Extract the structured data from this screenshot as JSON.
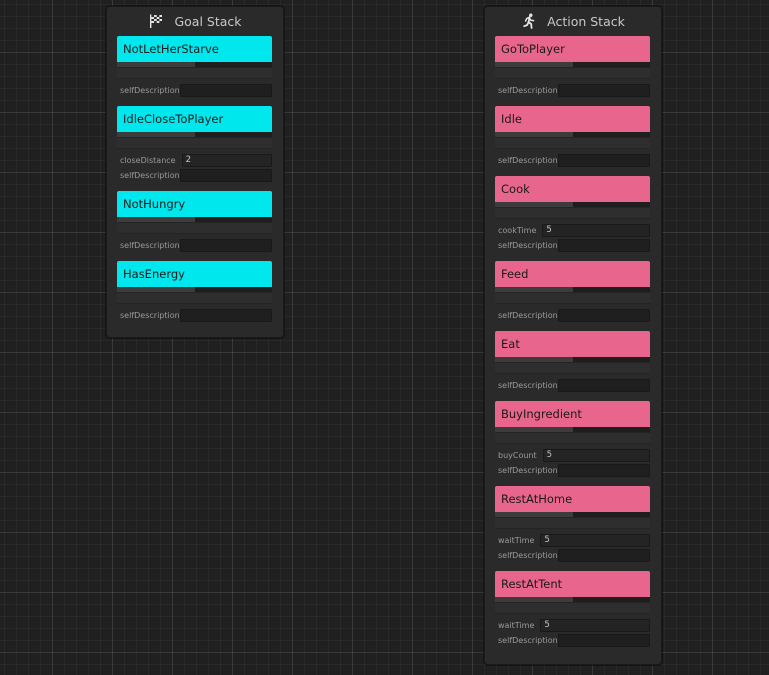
{
  "goal_stack": {
    "title": "Goal Stack",
    "icon": "checkered-flag-icon",
    "accent_color": "#00e8ed",
    "nodes": [
      {
        "name": "NotLetHerStarve",
        "fields": [
          {
            "label": "selfDescription",
            "value": ""
          }
        ]
      },
      {
        "name": "IdleCloseToPlayer",
        "fields": [
          {
            "label": "closeDistance",
            "value": "2"
          },
          {
            "label": "selfDescription",
            "value": ""
          }
        ]
      },
      {
        "name": "NotHungry",
        "fields": [
          {
            "label": "selfDescription",
            "value": ""
          }
        ]
      },
      {
        "name": "HasEnergy",
        "fields": [
          {
            "label": "selfDescription",
            "value": ""
          }
        ]
      }
    ]
  },
  "action_stack": {
    "title": "Action Stack",
    "icon": "running-person-icon",
    "accent_color": "#e8668d",
    "nodes": [
      {
        "name": "GoToPlayer",
        "fields": [
          {
            "label": "selfDescription",
            "value": ""
          }
        ]
      },
      {
        "name": "Idle",
        "fields": [
          {
            "label": "selfDescription",
            "value": ""
          }
        ]
      },
      {
        "name": "Cook",
        "fields": [
          {
            "label": "cookTime",
            "value": "5"
          },
          {
            "label": "selfDescription",
            "value": ""
          }
        ]
      },
      {
        "name": "Feed",
        "fields": [
          {
            "label": "selfDescription",
            "value": ""
          }
        ]
      },
      {
        "name": "Eat",
        "fields": [
          {
            "label": "selfDescription",
            "value": ""
          }
        ]
      },
      {
        "name": "BuyIngredient",
        "fields": [
          {
            "label": "buyCount",
            "value": "5"
          },
          {
            "label": "selfDescription",
            "value": ""
          }
        ]
      },
      {
        "name": "RestAtHome",
        "fields": [
          {
            "label": "waitTime",
            "value": "5"
          },
          {
            "label": "selfDescription",
            "value": ""
          }
        ]
      },
      {
        "name": "RestAtTent",
        "fields": [
          {
            "label": "waitTime",
            "value": "5"
          },
          {
            "label": "selfDescription",
            "value": ""
          }
        ]
      }
    ]
  }
}
